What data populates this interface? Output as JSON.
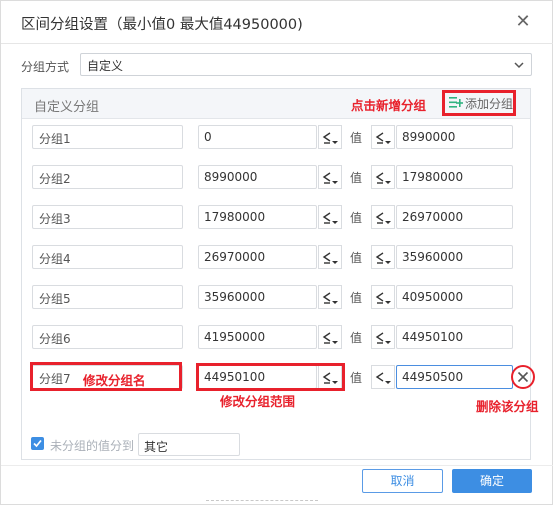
{
  "dialog": {
    "title": "区间分组设置（最小值0 最大值44950000)",
    "close_glyph": "✕"
  },
  "method": {
    "label": "分组方式",
    "value": "自定义"
  },
  "panel": {
    "title": "自定义分组",
    "add_label": "添加分组"
  },
  "value_label": "值",
  "groups": [
    {
      "name": "分组1",
      "lo": "0",
      "hi": "8990000"
    },
    {
      "name": "分组2",
      "lo": "8990000",
      "hi": "17980000"
    },
    {
      "name": "分组3",
      "lo": "17980000",
      "hi": "26970000"
    },
    {
      "name": "分组4",
      "lo": "26970000",
      "hi": "35960000"
    },
    {
      "name": "分组5",
      "lo": "35960000",
      "hi": "40950000"
    },
    {
      "name": "分组6",
      "lo": "41950000",
      "hi": "44950100"
    },
    {
      "name": "分组7",
      "lo": "44950100",
      "hi": "44950500"
    }
  ],
  "ungrouped": {
    "checked": true,
    "label": "未分组的值分到",
    "value": "其它"
  },
  "footer": {
    "cancel": "取消",
    "ok": "确定"
  },
  "annotations": {
    "add_group": "点击新增分组",
    "rename": "修改分组名",
    "range": "修改分组范围",
    "delete": "删除该分组"
  },
  "colors": {
    "accent": "#3d8ee3",
    "annotation": "#e8212c",
    "add_icon": "#2fb380"
  }
}
